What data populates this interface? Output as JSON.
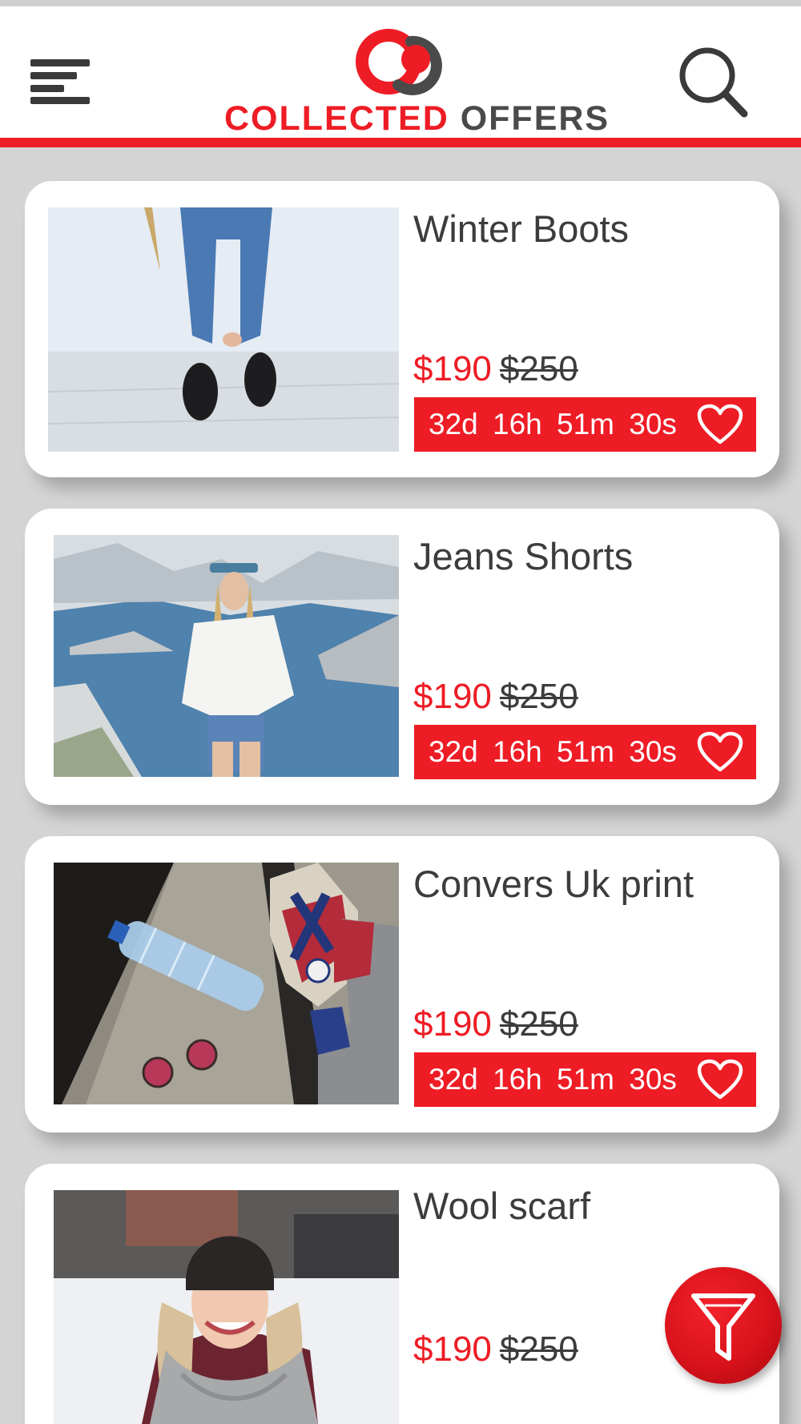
{
  "header": {
    "logo_text_red": "COLLECTED ",
    "logo_text_grey": "OFFERS",
    "menu_icon": "hamburger-menu-icon",
    "search_icon": "search-icon"
  },
  "colors": {
    "accent": "#ee1c25",
    "text": "#3c3c3c",
    "background": "#d4d4d4",
    "card": "#ffffff"
  },
  "products": [
    {
      "title": "Winter Boots",
      "price": "$190",
      "old_price": "$250",
      "countdown": "32d 16h 51m 30s",
      "image": "woman in ripped jeans and black boots"
    },
    {
      "title": "Jeans Shorts",
      "price": "$190",
      "old_price": "$250",
      "countdown": "32d 16h 51m 30s",
      "image": "woman in white blouse and denim shorts by the sea"
    },
    {
      "title": "Convers Uk print",
      "price": "$190",
      "old_price": "$250",
      "countdown": "32d 16h 51m 30s",
      "image": "union jack sneakers, water bottle and sunglasses on stone steps"
    },
    {
      "title": "Wool scarf",
      "price": "$190",
      "old_price": "$250",
      "image": "smiling woman in beanie and grey wool scarf in snow"
    }
  ],
  "fab": {
    "icon": "filter-icon"
  }
}
